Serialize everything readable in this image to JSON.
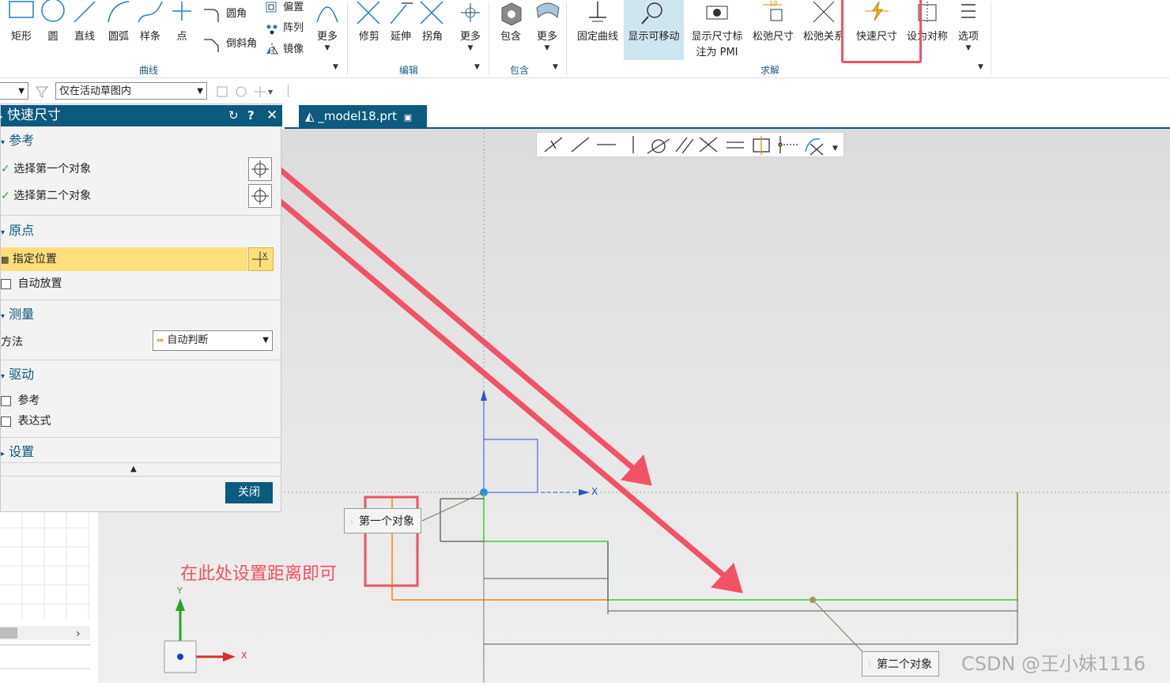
{
  "ribbon": {
    "groups": {
      "curve": {
        "label": "曲线",
        "buttons": [
          "矩形",
          "圆",
          "直线",
          "圆弧",
          "样条",
          "点"
        ],
        "small": [
          "圆角",
          "倒斜角",
          "偏置",
          "阵列",
          "镜像"
        ],
        "more": "更多"
      },
      "edit": {
        "label": "编辑",
        "buttons": [
          "修剪",
          "延伸",
          "拐角"
        ],
        "more": "更多"
      },
      "include": {
        "label": "包含",
        "buttons": [
          "包含"
        ],
        "more": "更多"
      },
      "solve": {
        "label": "求解",
        "fixed": "固定曲线",
        "movable": "显示可移动",
        "pmi": "显示尺寸标注为 PMI",
        "relax_dim": "松弛尺寸",
        "relax_rel": "松弛关系",
        "quick_dim": "快速尺寸",
        "symmetric": "设为对称",
        "options": "选项"
      }
    }
  },
  "filterbar": {
    "scope": "仅在活动草图内"
  },
  "tab": {
    "label": "_model18.prt"
  },
  "dialog": {
    "title": "快速尺寸",
    "sections": {
      "reference": "参考",
      "origin": "原点",
      "measure": "测量",
      "drive": "驱动",
      "settings": "设置"
    },
    "rows": {
      "first_obj": "选择第一个对象",
      "second_obj": "选择第二个对象",
      "specify_loc": "指定位置",
      "auto_place": "自动放置",
      "method_label": "方法",
      "method_value": "自动判断",
      "ref": "参考",
      "expression": "表达式"
    },
    "close": "关闭"
  },
  "canvas": {
    "first_label": "第一个对象",
    "second_label": "第二个对象",
    "axis_x": "X",
    "axis_y": "Y"
  },
  "annotation": "在此处设置距离即可",
  "watermark": "CSDN @王小妹1116",
  "colors": {
    "accent": "#0c5a7e",
    "highlight": "#ffdf7a",
    "arrow": "#f25266"
  }
}
